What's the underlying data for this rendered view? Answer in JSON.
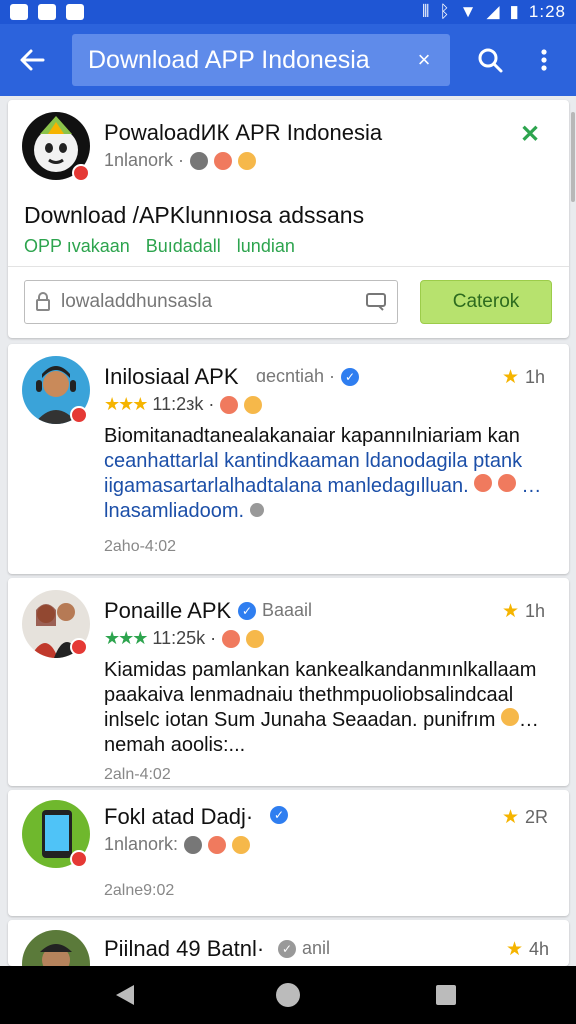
{
  "status": {
    "time": "1:28"
  },
  "app_bar": {
    "search_text": "Download APP Indonesia",
    "close": "×"
  },
  "header_card": {
    "title": "PowaloadИК APR Indonesia",
    "meta": "1nlanork ·",
    "close": "✕",
    "heading": "Download /APKlunnıosa adssans",
    "chips": [
      "OPP ıvakaan",
      "Buıdadall",
      "lundian"
    ],
    "input_placeholder": "lowaladdhunsasla",
    "button_label": "Caterok"
  },
  "posts": [
    {
      "title": "Inilosiaal APK",
      "meta": "ɑecntiah ·",
      "time": "1h",
      "rating_meta": "11:2зk ·",
      "body": [
        "Biomitanadtanealаkanaiar kapannılniariam kan",
        "ceanhattarlal kantindkaaman ldanodagila ptank",
        "iigamasartarlalhadtalana manledagılluan."
      ],
      "link": "lnasamliadoom.",
      "date": "2aho-4:02",
      "stars_green": false
    },
    {
      "title": "Ponaille APK",
      "meta": "Baaail",
      "time": "1h",
      "rating_meta": "11:25k ·",
      "body": [
        "Kiamidas pamlankan kankealkandanmınlkallaam",
        "paakaiva lenmadnaiu thethmpuoliobsalindcaal",
        "inlselc iotan Sum Junaha Seaadan. punifrım"
      ],
      "link": "nemah aoolis:...",
      "date": "2aln-4:02",
      "stars_green": true
    },
    {
      "title": "Fokl atad Dadj·",
      "meta": "1nlanork:",
      "time": "2R",
      "date": "2alne9:02"
    },
    {
      "title": "Piilnad 49 Batnl·",
      "meta": "anil",
      "time": "4h"
    }
  ],
  "colors": {
    "primary": "#2c63dc",
    "accent_green": "#2da44e",
    "button_green": "#b7e26e"
  }
}
